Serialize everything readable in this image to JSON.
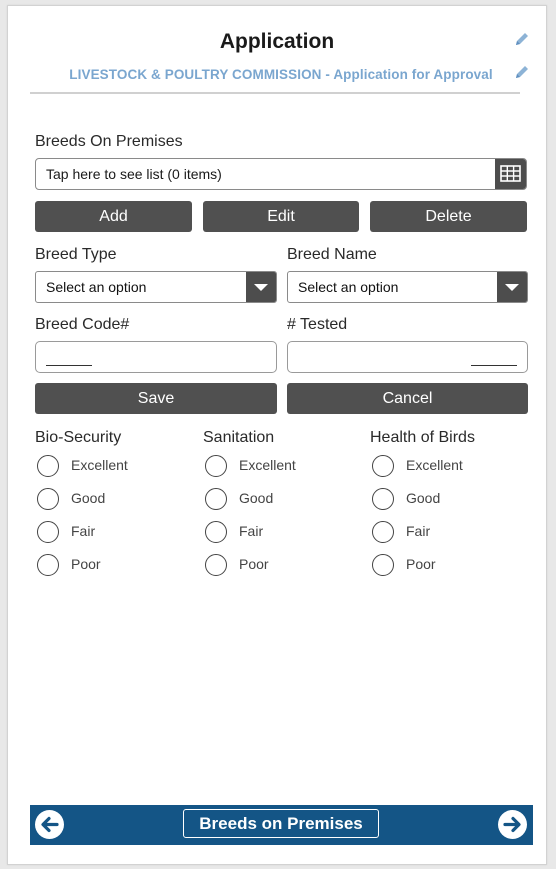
{
  "header": {
    "title": "Application",
    "subtitle": "LIVESTOCK & POULTRY COMMISSION - Application for Approval"
  },
  "breeds_list": {
    "label": "Breeds On Premises",
    "value": "Tap here to see list (0 items)"
  },
  "list_actions": {
    "add": "Add",
    "edit": "Edit",
    "delete": "Delete"
  },
  "breed_type": {
    "label": "Breed Type",
    "value": "Select an option"
  },
  "breed_name": {
    "label": "Breed Name",
    "value": "Select an option"
  },
  "breed_code": {
    "label": "Breed Code#",
    "value": ""
  },
  "tested": {
    "label": "# Tested",
    "value": ""
  },
  "form_actions": {
    "save": "Save",
    "cancel": "Cancel"
  },
  "ratings": [
    {
      "label": "Bio-Security",
      "options": [
        "Excellent",
        "Good",
        "Fair",
        "Poor"
      ]
    },
    {
      "label": "Sanitation",
      "options": [
        "Excellent",
        "Good",
        "Fair",
        "Poor"
      ]
    },
    {
      "label": "Health of Birds",
      "options": [
        "Excellent",
        "Good",
        "Fair",
        "Poor"
      ]
    }
  ],
  "footer": {
    "title": "Breeds on Premises"
  },
  "colors": {
    "accent": "#145586",
    "subtitle": "#7aa6cf",
    "button": "#505050"
  },
  "icons": [
    "pencil-icon",
    "grid-icon",
    "chevron-down-icon",
    "arrow-left-icon",
    "arrow-right-icon"
  ]
}
